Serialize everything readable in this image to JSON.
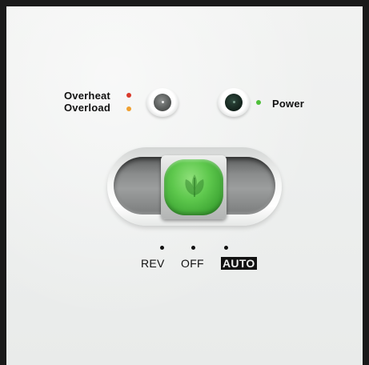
{
  "indicators": {
    "overheat": {
      "label": "Overheat",
      "dot_color": "#d93a2b"
    },
    "overload": {
      "label": "Overload",
      "dot_color": "#f0a030"
    },
    "power": {
      "label": "Power",
      "dot_color": "#4fbf3a"
    }
  },
  "switch": {
    "positions": [
      {
        "label": "REV"
      },
      {
        "label": "OFF"
      },
      {
        "label": "AUTO"
      }
    ],
    "selected": "AUTO",
    "knob_color": "#5ec84d",
    "knob_icon": "leaf-icon"
  }
}
